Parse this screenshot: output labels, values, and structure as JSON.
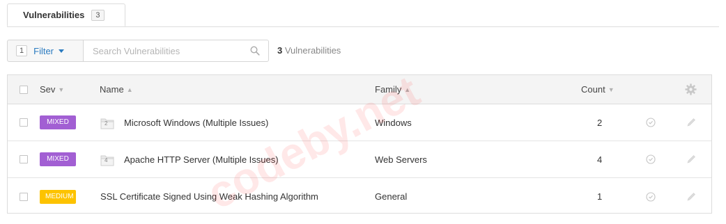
{
  "tab": {
    "label": "Vulnerabilities",
    "count": "3"
  },
  "filter": {
    "count": "1",
    "label": "Filter"
  },
  "search": {
    "placeholder": "Search Vulnerabilities",
    "value": ""
  },
  "summary": {
    "count": "3",
    "label": "Vulnerabilities"
  },
  "table": {
    "columns": {
      "sev": "Sev",
      "name": "Name",
      "family": "Family",
      "count": "Count"
    },
    "rows": [
      {
        "severity": "MIXED",
        "severity_color": "#a25fd3",
        "group_count": "2",
        "name": "Microsoft Windows (Multiple Issues)",
        "family": "Windows",
        "count": "2"
      },
      {
        "severity": "MIXED",
        "severity_color": "#a25fd3",
        "group_count": "4",
        "name": "Apache HTTP Server (Multiple Issues)",
        "family": "Web Servers",
        "count": "4"
      },
      {
        "severity": "MEDIUM",
        "severity_color": "#fdc300",
        "group_count": "",
        "name": "SSL Certificate Signed Using Weak Hashing Algorithm",
        "family": "General",
        "count": "1"
      }
    ]
  },
  "watermark": "codeby.net",
  "colors": {
    "accent": "#2b7bc0",
    "mixed": "#a25fd3",
    "medium": "#fdc300"
  }
}
